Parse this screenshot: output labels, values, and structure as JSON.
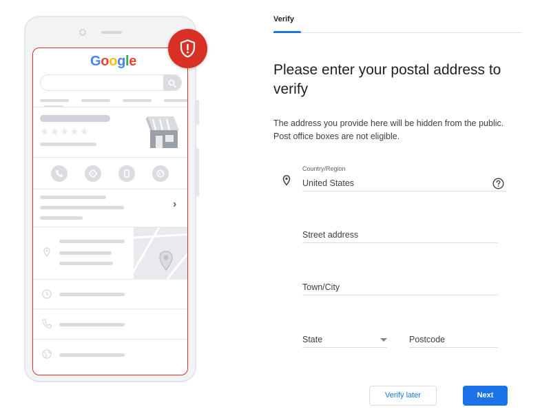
{
  "illustration": {
    "logo_letters": [
      {
        "ch": "G",
        "color": "#4285f4"
      },
      {
        "ch": "o",
        "color": "#ea4335"
      },
      {
        "ch": "o",
        "color": "#fbbc05"
      },
      {
        "ch": "g",
        "color": "#4285f4"
      },
      {
        "ch": "l",
        "color": "#34a853"
      },
      {
        "ch": "e",
        "color": "#ea4335"
      }
    ],
    "rating_stars": "★★★★★",
    "badge_icon": "shield-alert-icon",
    "badge_color": "#d93025",
    "row_icons": [
      "location-pin-icon",
      "clock-icon",
      "phone-icon",
      "globe-icon"
    ],
    "action_icons": [
      "phone-icon",
      "directions-icon",
      "save-icon",
      "globe-icon"
    ]
  },
  "tabs": [
    {
      "label": "Verify",
      "active": true
    }
  ],
  "page": {
    "heading": "Please enter your postal address to verify",
    "description": "The address you provide here will be hidden from the public. Post office boxes are not eligible."
  },
  "form": {
    "country": {
      "label": "Country/Region",
      "value": "United States"
    },
    "street": {
      "placeholder": "Street address"
    },
    "town": {
      "placeholder": "Town/City"
    },
    "state": {
      "placeholder": "State"
    },
    "postcode": {
      "placeholder": "Postcode"
    }
  },
  "buttons": {
    "verify_later": "Verify later",
    "next": "Next"
  },
  "colors": {
    "accent": "#1a73e8",
    "alert": "#d93025"
  }
}
